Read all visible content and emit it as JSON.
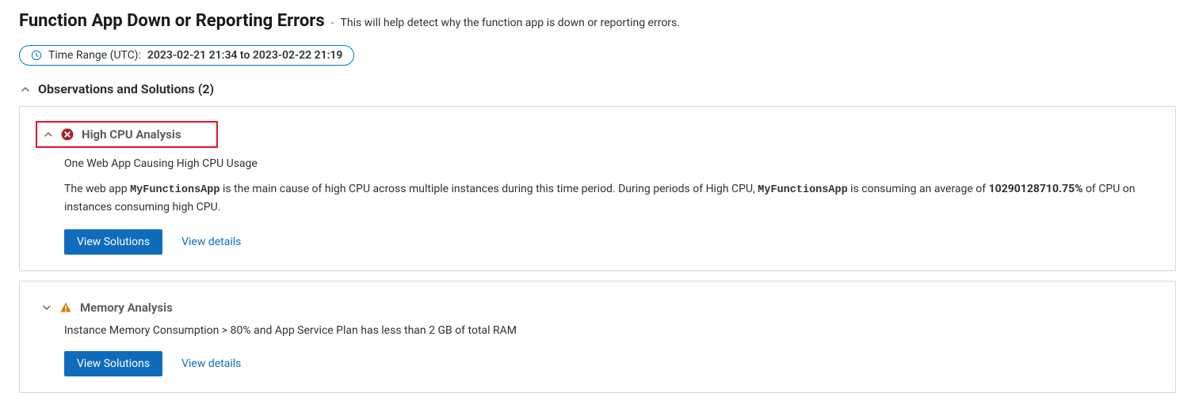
{
  "header": {
    "title": "Function App Down or Reporting Errors",
    "sep": "-",
    "subtitle": "This will help detect why the function app is down or reporting errors."
  },
  "timeRange": {
    "label": "Time Range (UTC):",
    "value": "2023-02-21 21:34 to 2023-02-22 21:19"
  },
  "section": {
    "heading": "Observations and Solutions (2)"
  },
  "cards": {
    "highCpu": {
      "title": "High CPU Analysis",
      "subtitle": "One Web App Causing High CPU Usage",
      "desc_p1": "The web app ",
      "app1": "MyFunctionsApp",
      "desc_p2": " is the main cause of high CPU across multiple instances during this time period. During periods of High CPU, ",
      "app2": "MyFunctionsApp",
      "desc_p3": " is consuming an average of ",
      "cpuPct": "10290128710.75%",
      "desc_p4": " of CPU on instances consuming high CPU.",
      "viewSolutions": "View Solutions",
      "viewDetails": "View details"
    },
    "memory": {
      "title": "Memory Analysis",
      "subtitle": "Instance Memory Consumption > 80% and App Service Plan has less than 2 GB of total RAM",
      "viewSolutions": "View Solutions",
      "viewDetails": "View details"
    }
  }
}
